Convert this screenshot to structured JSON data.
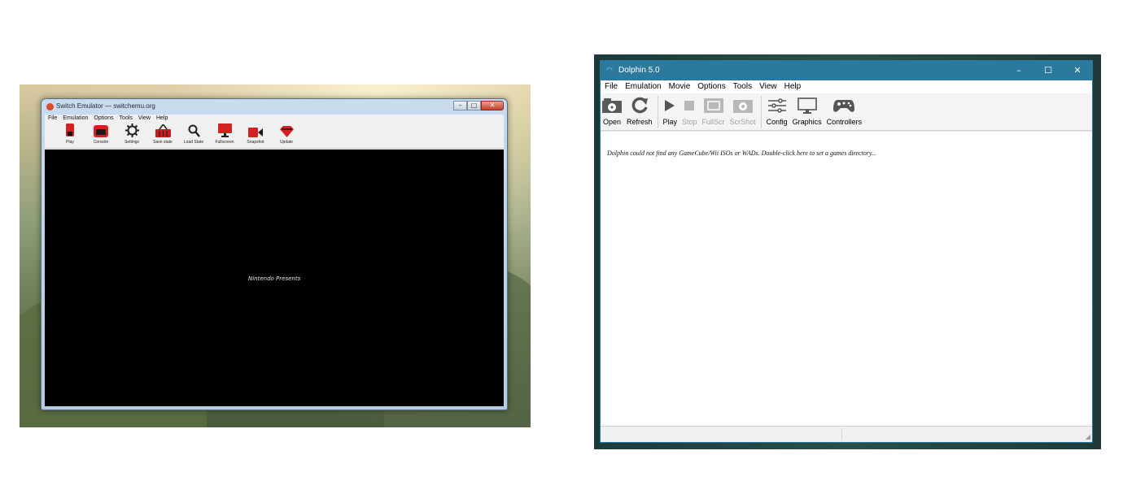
{
  "left_screenshot": {
    "window_title": "Switch Emulator — switchemu.org",
    "window_controls": [
      "–",
      "□",
      "✕"
    ],
    "menu": [
      "File",
      "Emulation",
      "Options",
      "Tools",
      "View",
      "Help"
    ],
    "toolbar": [
      {
        "label": "Play",
        "icon": "play-icon"
      },
      {
        "label": "Console",
        "icon": "console-icon"
      },
      {
        "label": "Settings",
        "icon": "settings-icon"
      },
      {
        "label": "Save state",
        "icon": "save-state-icon"
      },
      {
        "label": "Load State",
        "icon": "search-icon"
      },
      {
        "label": "Fullscreen",
        "icon": "monitor-icon"
      },
      {
        "label": "Snapshot",
        "icon": "camera-icon"
      },
      {
        "label": "Update",
        "icon": "update-icon"
      }
    ],
    "screen_text": "Nintendo Presents",
    "accent_color": "#d32020"
  },
  "right_screenshot": {
    "window_title": "Dolphin 5.0",
    "window_controls": [
      "–",
      "☐",
      "✕"
    ],
    "menu": [
      "File",
      "Emulation",
      "Movie",
      "Options",
      "Tools",
      "View",
      "Help"
    ],
    "toolbar": [
      {
        "label": "Open",
        "icon": "open-icon",
        "enabled": true
      },
      {
        "label": "Refresh",
        "icon": "refresh-icon",
        "enabled": true
      },
      {
        "label": "Play",
        "icon": "play-icon",
        "enabled": true
      },
      {
        "label": "Stop",
        "icon": "stop-icon",
        "enabled": false
      },
      {
        "label": "FullScr",
        "icon": "fullscreen-icon",
        "enabled": false
      },
      {
        "label": "ScrShot",
        "icon": "screenshot-icon",
        "enabled": false
      },
      {
        "label": "Config",
        "icon": "config-icon",
        "enabled": true
      },
      {
        "label": "Graphics",
        "icon": "graphics-icon",
        "enabled": true
      },
      {
        "label": "Controllers",
        "icon": "controllers-icon",
        "enabled": true
      }
    ],
    "empty_list_message": "Dolphin could not find any GameCube/Wii ISOs or WADs. Double-click here to set a games directory...",
    "title_bar_color": "#2b7a9d"
  }
}
